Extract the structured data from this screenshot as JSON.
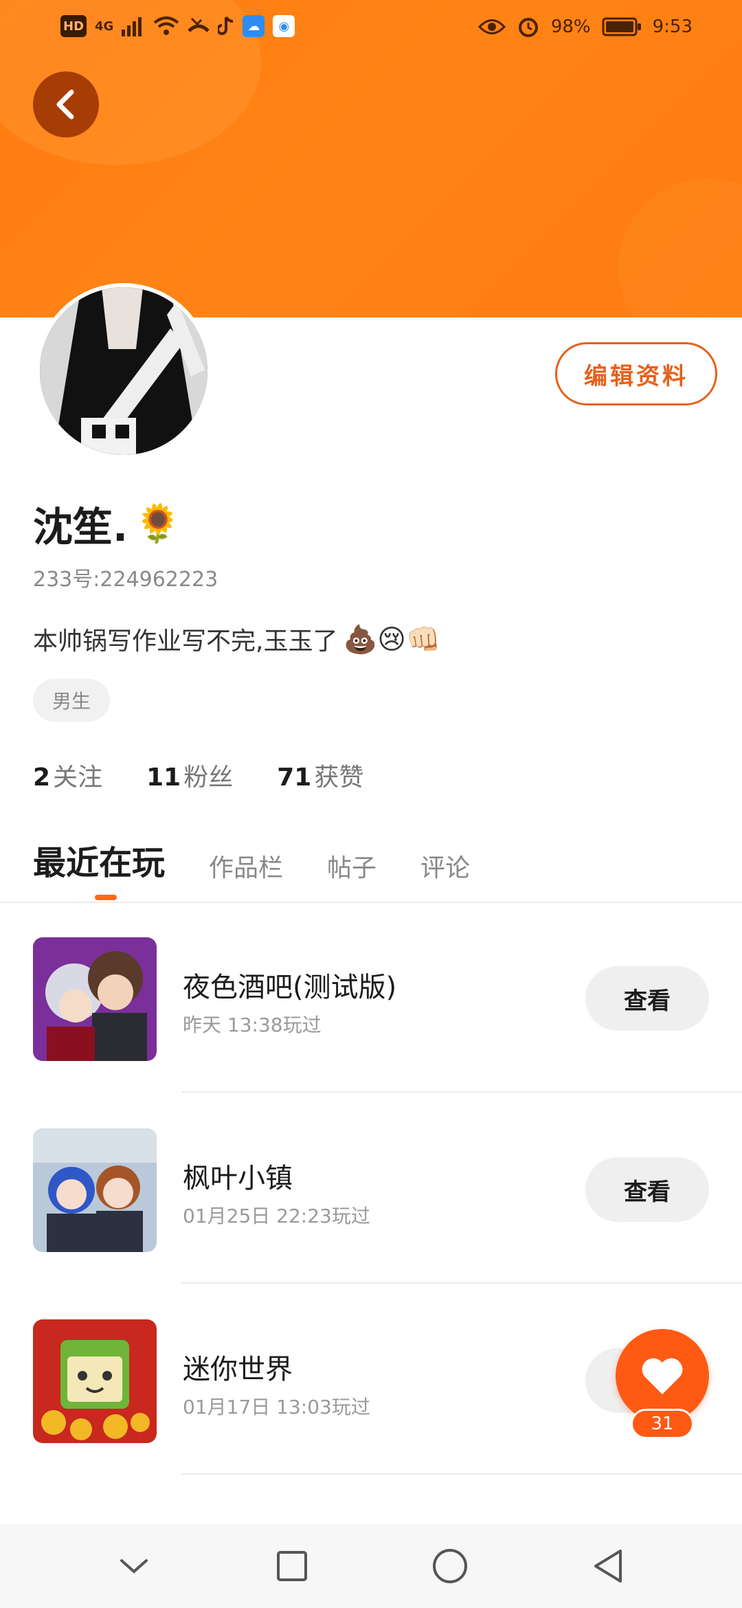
{
  "status_bar": {
    "left_icons": [
      "hd-icon",
      "4g-signal-icon",
      "wifi-icon",
      "missed-call-icon",
      "tiktok-icon",
      "weather-icon",
      "browser-icon"
    ],
    "hd_label": "HD",
    "network_label": "4G",
    "battery_percent": "98%",
    "time": "9:53"
  },
  "header": {
    "back_icon": "chevron-left-icon",
    "color": "#ff7a10"
  },
  "profile": {
    "name": "沈笙.",
    "name_emoji": "🌻",
    "uid": "233号:224962223",
    "bio": "本帅锅写作业写不完,玉玉了",
    "bio_emojis": "💩😢👊🏻",
    "tag": "男生",
    "edit_label": "编辑资料"
  },
  "stats": [
    {
      "num": "2",
      "label": "关注"
    },
    {
      "num": "11",
      "label": "粉丝"
    },
    {
      "num": "71",
      "label": "获赞"
    }
  ],
  "tabs": [
    {
      "label": "最近在玩",
      "active": true
    },
    {
      "label": "作品栏",
      "active": false
    },
    {
      "label": "帖子",
      "active": false
    },
    {
      "label": "评论",
      "active": false
    }
  ],
  "games": [
    {
      "title": "夜色酒吧(测试版)",
      "played": "昨天 13:38玩过",
      "button": "查看"
    },
    {
      "title": "枫叶小镇",
      "played": "01月25日 22:23玩过",
      "button": "查看"
    },
    {
      "title": "迷你世界",
      "played": "01月17日 13:03玩过",
      "button": "查看"
    }
  ],
  "fab": {
    "icon": "heart-icon",
    "count": "31"
  },
  "nav": [
    "chevron-down-icon",
    "recent-apps-icon",
    "home-icon",
    "back-icon"
  ],
  "accent": "#ff6a1a"
}
